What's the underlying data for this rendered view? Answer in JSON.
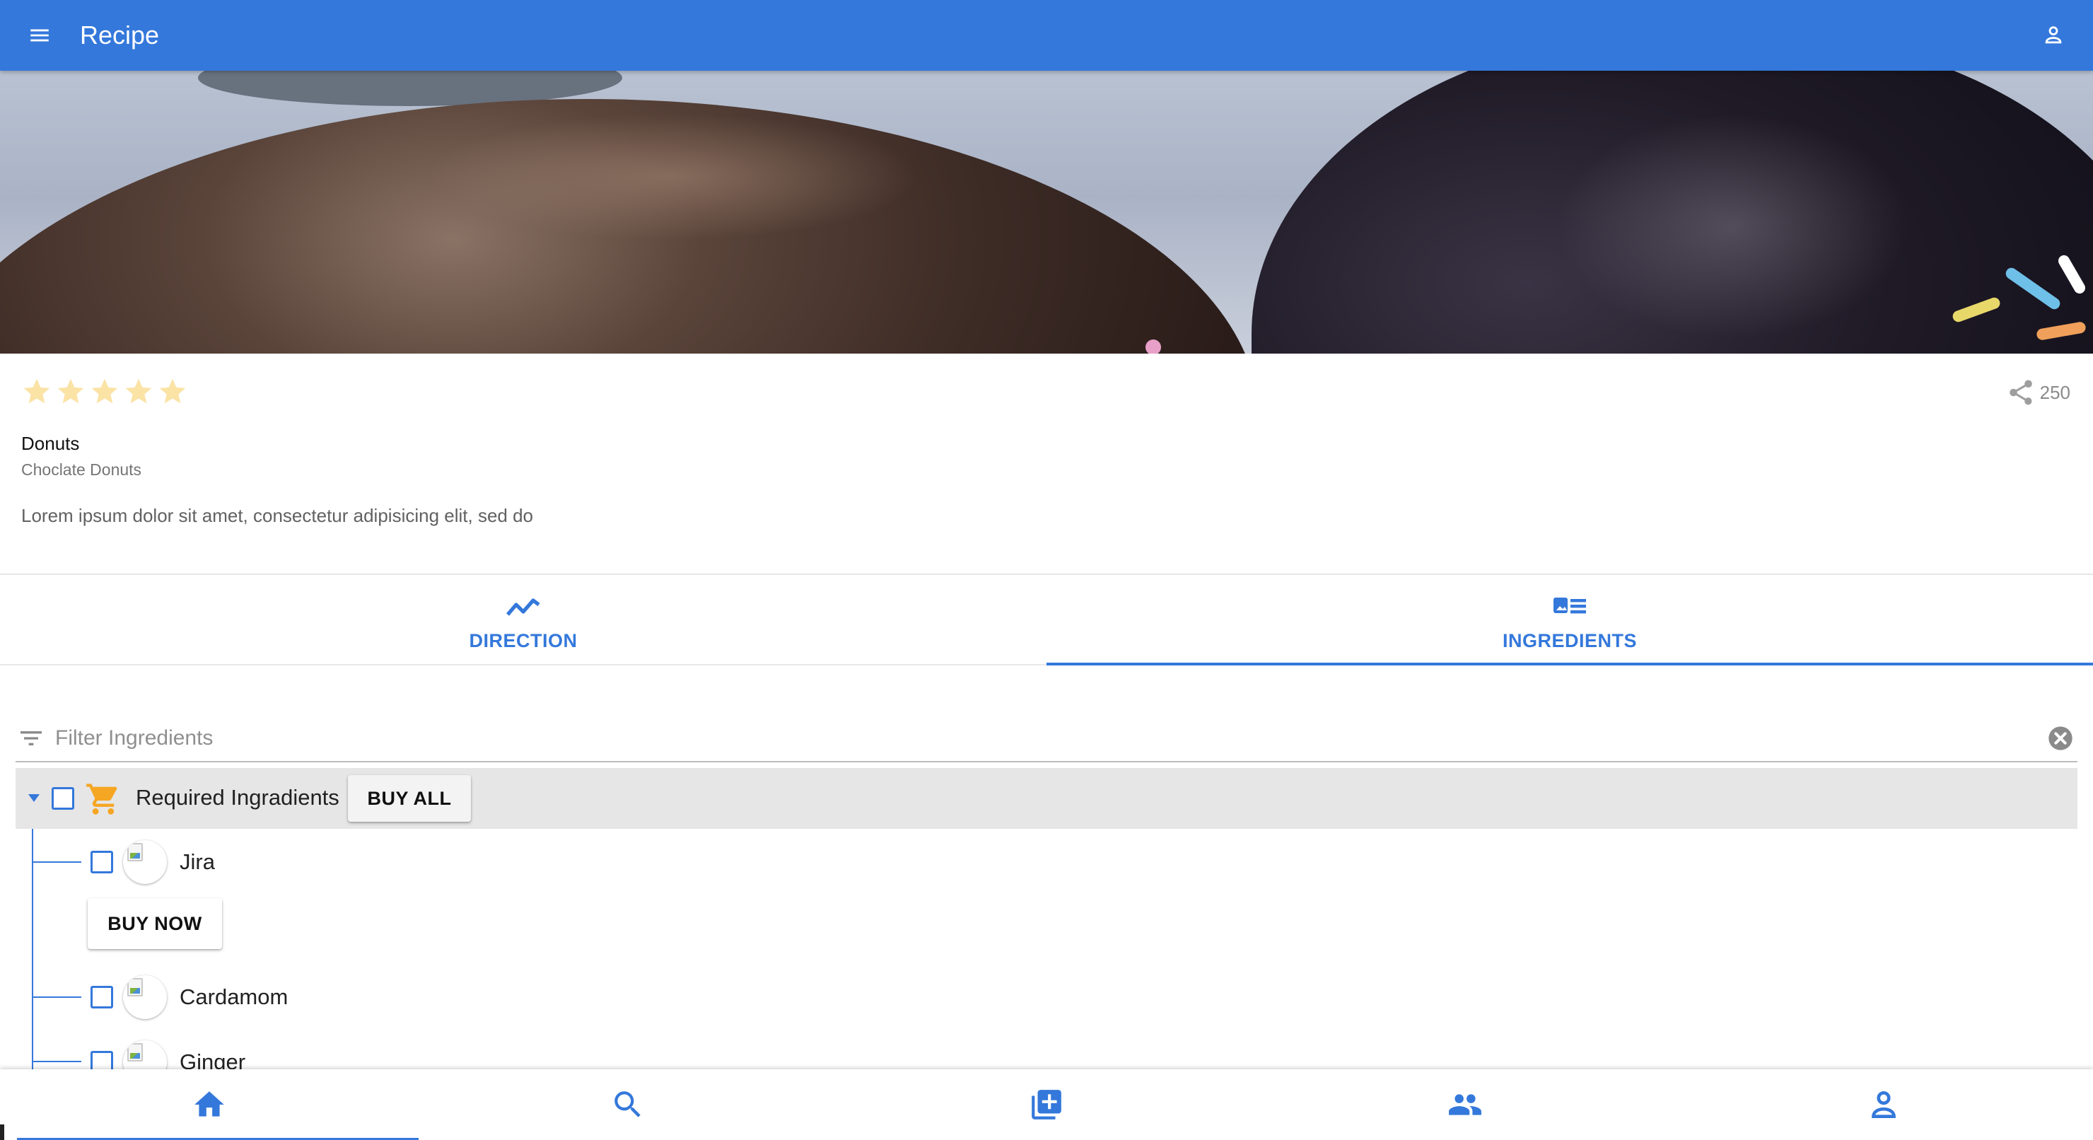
{
  "appbar": {
    "title": "Recipe",
    "color": "#3478db",
    "menu_icon": "menu-icon",
    "account_icon": "account-icon"
  },
  "recipe": {
    "rating": {
      "value": 5,
      "max": 5,
      "star_color": "#fbe3a6"
    },
    "share_count": "250",
    "title": "Donuts",
    "subtitle": "Choclate Donuts",
    "description": "Lorem ipsum dolor sit amet, consectetur adipisicing elit, sed do"
  },
  "tabs": [
    {
      "label": "DIRECTION",
      "icon": "trending-icon",
      "active": false
    },
    {
      "label": "INGREDIENTS",
      "icon": "ingredients-icon",
      "active": true
    }
  ],
  "filter": {
    "placeholder": "Filter Ingredients",
    "value": ""
  },
  "ingredient_group": {
    "label": "Required Ingradients",
    "expanded": true,
    "checked": false,
    "buy_all_label": "BUY ALL",
    "cart_color": "#f5a623",
    "items": [
      {
        "name": "Jira",
        "checked": false,
        "buy_now_label": "BUY NOW"
      },
      {
        "name": "Cardamom",
        "checked": false
      },
      {
        "name": "Ginger",
        "checked": false
      }
    ]
  },
  "bottom_nav": [
    {
      "name": "home",
      "icon": "home-icon",
      "active": true
    },
    {
      "name": "search",
      "icon": "search-icon",
      "active": false
    },
    {
      "name": "add",
      "icon": "add-box-icon",
      "active": false
    },
    {
      "name": "people",
      "icon": "people-icon",
      "active": false
    },
    {
      "name": "profile",
      "icon": "person-icon",
      "active": false
    }
  ]
}
